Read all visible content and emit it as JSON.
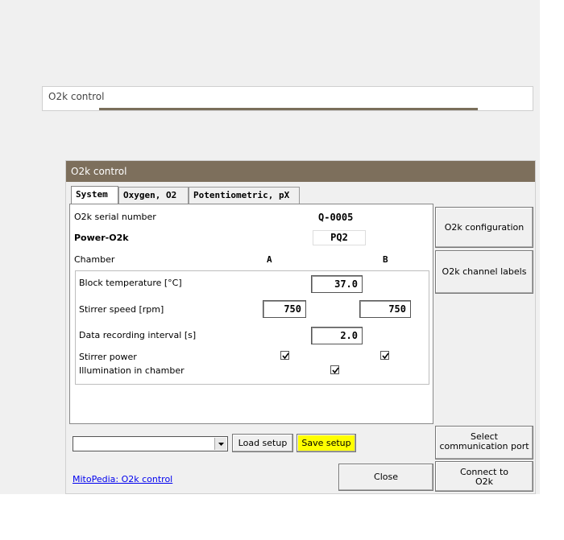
{
  "mini_window": {
    "title": "O2k control"
  },
  "dialog": {
    "title": "O2k control",
    "tabs": [
      {
        "label": "System",
        "active": true
      },
      {
        "label": "Oxygen, O2",
        "active": false
      },
      {
        "label": "Potentiometric, pX",
        "active": false
      }
    ],
    "system": {
      "serial_label": "O2k serial number",
      "serial_value": "Q-0005",
      "power_label": "Power-O2k",
      "power_value": "PQ2",
      "chamber_label": "Chamber",
      "chamber_a": "A",
      "chamber_b": "B",
      "block_temp_label": "Block temperature [°C]",
      "block_temp_value": "37.0",
      "stirrer_speed_label": "Stirrer speed [rpm]",
      "stirrer_speed_a": "750",
      "stirrer_speed_b": "750",
      "data_interval_label": "Data recording interval [s]",
      "data_interval_value": "2.0",
      "stirrer_power_label": "Stirrer power",
      "stirrer_power_a": true,
      "stirrer_power_b": true,
      "illumination_label": "Illumination in chamber",
      "illumination_checked": true
    },
    "side_buttons": {
      "config": "O2k configuration",
      "channel_labels": "O2k channel labels",
      "select_port_line1": "Select",
      "select_port_line2": "communication port",
      "connect_line1": "Connect to",
      "connect_line2": "O2k"
    },
    "bottom": {
      "setup_select_value": "",
      "load_setup": "Load setup",
      "save_setup": "Save setup",
      "mitopedia_link": "MitoPedia: O2k control",
      "close": "Close"
    },
    "colors": {
      "titlebar": "#7d6f5c",
      "save_setup_bg": "#ffff00",
      "link": "#0000ee"
    }
  }
}
